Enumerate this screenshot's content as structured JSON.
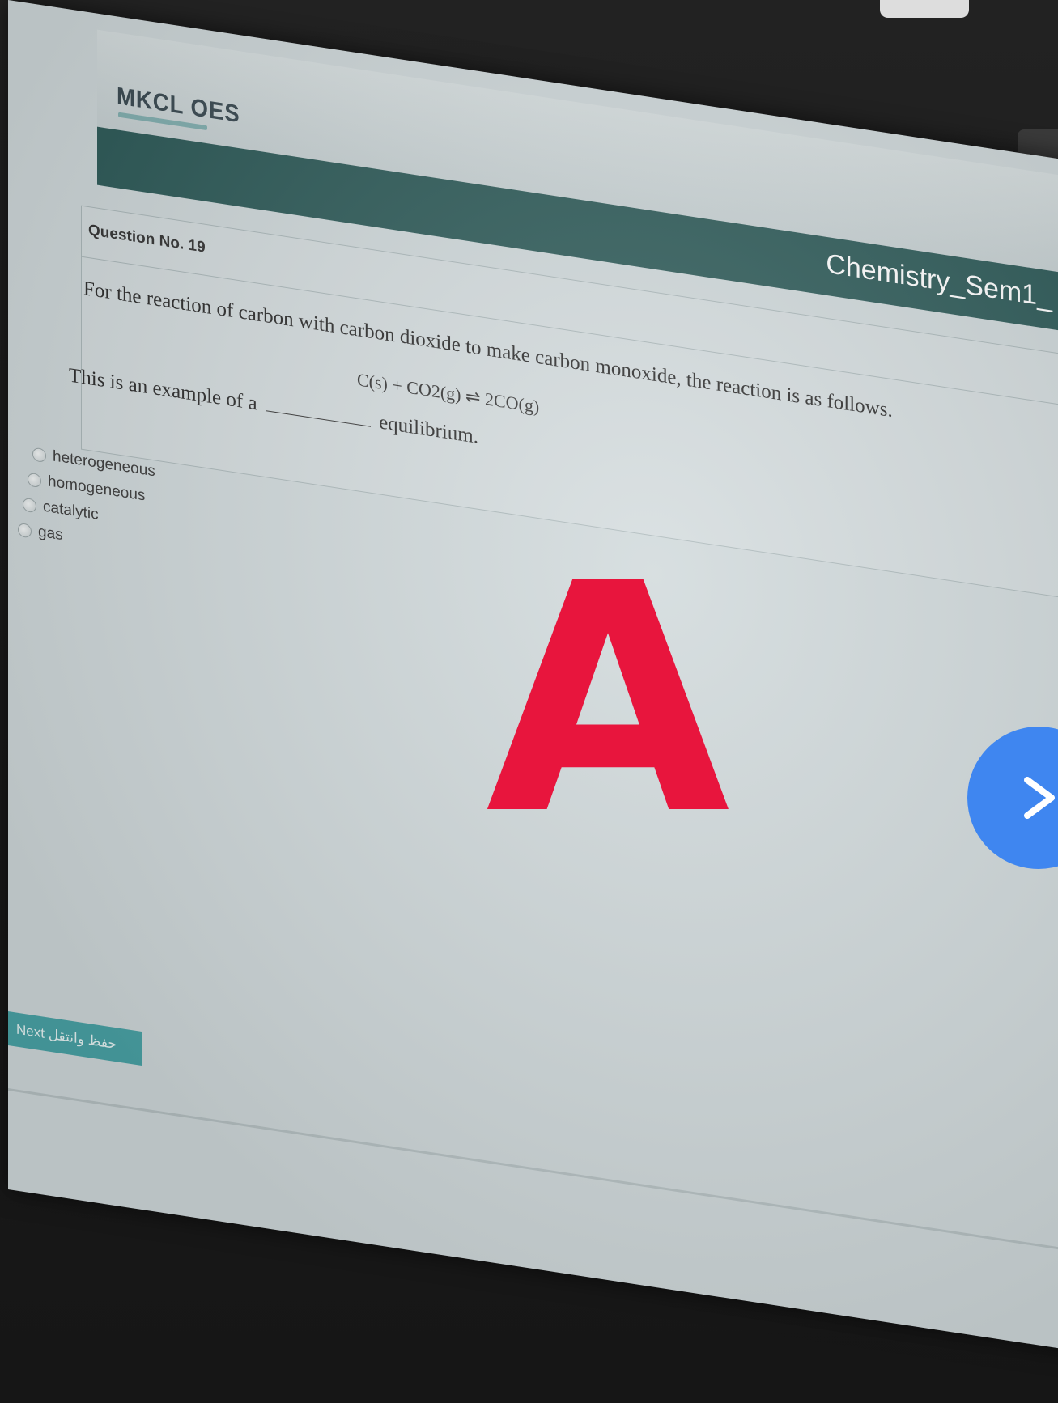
{
  "app": {
    "logo_text": "MKCL OES"
  },
  "header": {
    "subject_title": "Chemistry_Sem1_"
  },
  "question": {
    "number_label": "Question No. 19",
    "text": "For the reaction of carbon with carbon dioxide to make carbon monoxide, the reaction is as follows.",
    "equation": "C(s) + CO2(g) ⇌ 2CO(g)",
    "stem_prefix": "This is an example of a",
    "stem_suffix": "equilibrium."
  },
  "options": [
    {
      "label": "heterogeneous",
      "selected": false
    },
    {
      "label": "homogeneous",
      "selected": false
    },
    {
      "label": "catalytic",
      "selected": false
    },
    {
      "label": "gas",
      "selected": false
    }
  ],
  "buttons": {
    "next_label": "Next حفظ وانتقل"
  },
  "overlay": {
    "answer_letter": "A",
    "next_icon": "chevron-right-icon",
    "letter_color": "#e8153d",
    "circle_color": "#3f86f0"
  },
  "colors": {
    "title_bar": "#2d5a58",
    "screen_bg": "#cfd8da",
    "next_button": "#4aa3a6"
  }
}
